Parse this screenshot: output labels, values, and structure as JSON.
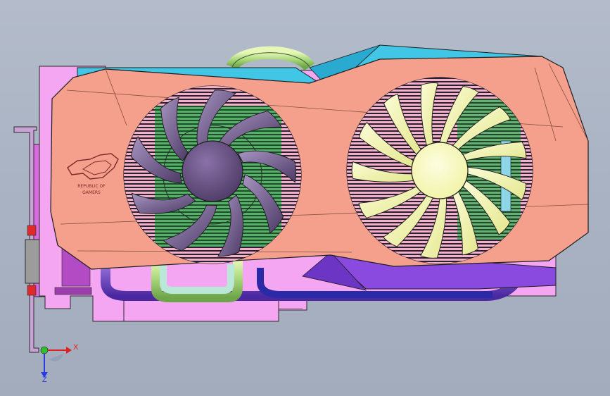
{
  "app": {
    "title": ""
  },
  "model": {
    "logo_text_line1": "REPUBLIC OF",
    "logo_text_line2": "GAMERS"
  },
  "triad": {
    "x_label": "X",
    "z_label": "Z"
  },
  "colors": {
    "background_top": "#b4bccb",
    "shroud": "#f4a08c",
    "accent_cyan": "#3fc8e6",
    "accent_purple": "#7a3dd8",
    "pcb_pink": "#f39af0",
    "fan_left_blades": "#6b4f86",
    "fan_right_blades": "#f5f7b0",
    "heatsink_green": "#3f9b56",
    "heatpipe_green": "#c8e88e",
    "bracket_magenta": "#e064e8"
  }
}
